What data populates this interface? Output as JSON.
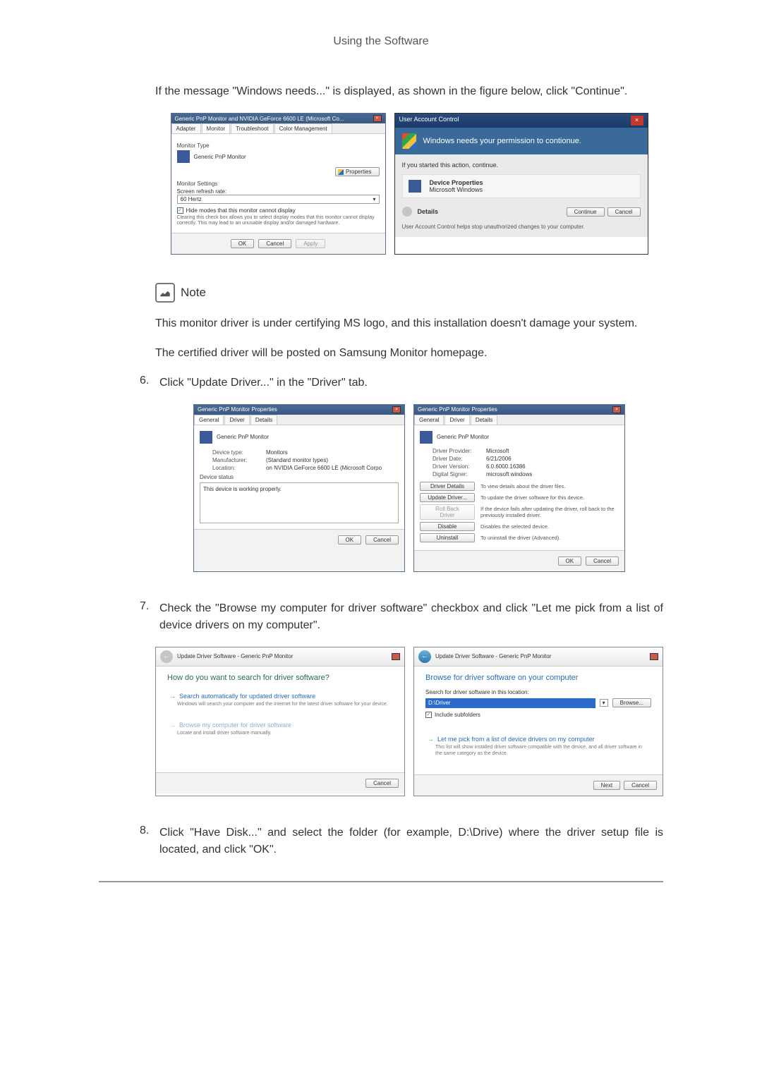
{
  "pageHeader": "Using the Software",
  "intro": "If the message \"Windows needs...\" is displayed, as shown in the figure below, click \"Continue\".",
  "figure1": {
    "monitorProps": {
      "title": "Generic PnP Monitor and NVIDIA GeForce 6600 LE (Microsoft Co...",
      "tabs": [
        "Adapter",
        "Monitor",
        "Troubleshoot",
        "Color Management"
      ],
      "activeTab": "Monitor",
      "typeLabel": "Monitor Type",
      "typeValue": "Generic PnP Monitor",
      "propertiesBtn": "Properties",
      "settingsHeader": "Monitor Settings",
      "refreshLabel": "Screen refresh rate:",
      "refreshValue": "60 Hertz",
      "hideCheck": "Hide modes that this monitor cannot display",
      "hideDesc": "Clearing this check box allows you to select display modes that this monitor cannot display correctly. This may lead to an unusable display and/or damaged hardware.",
      "ok": "OK",
      "cancel": "Cancel",
      "apply": "Apply"
    },
    "uac": {
      "title": "User Account Control",
      "banner": "Windows needs your permission to contionue.",
      "bodyIntro": "If you started this action, continue.",
      "progName": "Device Properties",
      "progPublisher": "Microsoft Windows",
      "details": "Details",
      "continue": "Continue",
      "cancel": "Cancel",
      "footer": "User Account Control helps stop unauthorized changes to your computer."
    }
  },
  "noteLabel": "Note",
  "noteLine1": "This monitor driver is under certifying MS logo, and this installation doesn't damage your system.",
  "noteLine2": "The certified driver will be posted on Samsung Monitor homepage.",
  "step6": {
    "num": "6.",
    "text": "Click \"Update Driver...\" in the \"Driver\" tab."
  },
  "figure2": {
    "generalProps": {
      "title": "Generic PnP Monitor Properties",
      "tabs": [
        "General",
        "Driver",
        "Details"
      ],
      "activeTab": "General",
      "name": "Generic PnP Monitor",
      "rows": [
        {
          "k": "Device type:",
          "v": "Monitors"
        },
        {
          "k": "Manufacturer:",
          "v": "(Standard monitor types)"
        },
        {
          "k": "Location:",
          "v": "on NVIDIA GeForce 6600 LE (Microsoft Corpo"
        }
      ],
      "statusHeader": "Device status",
      "statusText": "This device is working properly.",
      "ok": "OK",
      "cancel": "Cancel"
    },
    "driverProps": {
      "title": "Generic PnP Monitor Properties",
      "tabs": [
        "General",
        "Driver",
        "Details"
      ],
      "activeTab": "Driver",
      "name": "Generic PnP Monitor",
      "rows": [
        {
          "k": "Driver Provider:",
          "v": "Microsoft"
        },
        {
          "k": "Driver Date:",
          "v": "6/21/2006"
        },
        {
          "k": "Driver Version:",
          "v": "6.0.6000.16386"
        },
        {
          "k": "Digital Signer:",
          "v": "microsoft windows"
        }
      ],
      "buttons": [
        {
          "label": "Driver Details",
          "desc": "To view details about the driver files."
        },
        {
          "label": "Update Driver...",
          "desc": "To update the driver software for this device."
        },
        {
          "label": "Roll Back Driver",
          "desc": "If the device fails after updating the driver, roll back to the previously installed driver.",
          "disabled": true
        },
        {
          "label": "Disable",
          "desc": "Disables the selected device."
        },
        {
          "label": "Uninstall",
          "desc": "To uninstall the driver (Advanced)."
        }
      ],
      "ok": "OK",
      "cancel": "Cancel"
    }
  },
  "step7": {
    "num": "7.",
    "text": "Check the \"Browse my computer for driver software\" checkbox and click \"Let me pick from a list of device drivers on my computer\"."
  },
  "figure3": {
    "wiz1": {
      "breadcrumb": "Update Driver Software - Generic PnP Monitor",
      "heading": "How do you want to search for driver software?",
      "opt1": "Search automatically for updated driver software",
      "opt1desc": "Windows will search your computer and the Internet for the latest driver software for your device.",
      "opt2": "Browse my computer for driver software",
      "opt2desc": "Locate and install driver software manually.",
      "cancel": "Cancel"
    },
    "wiz2": {
      "breadcrumb": "Update Driver Software - Generic PnP Monitor",
      "heading": "Browse for driver software on your computer",
      "searchLabel": "Search for driver software in this location:",
      "path": "D:\\Driver",
      "browse": "Browse...",
      "include": "Include subfolders",
      "opt": "Let me pick from a list of device drivers on my computer",
      "optdesc": "This list will show installed driver software compatible with the device, and all driver software in the same category as the device.",
      "next": "Next",
      "cancel": "Cancel"
    }
  },
  "step8": {
    "num": "8.",
    "text": "Click \"Have Disk...\" and select the folder (for example, D:\\Drive) where the driver setup file is located, and click \"OK\"."
  }
}
